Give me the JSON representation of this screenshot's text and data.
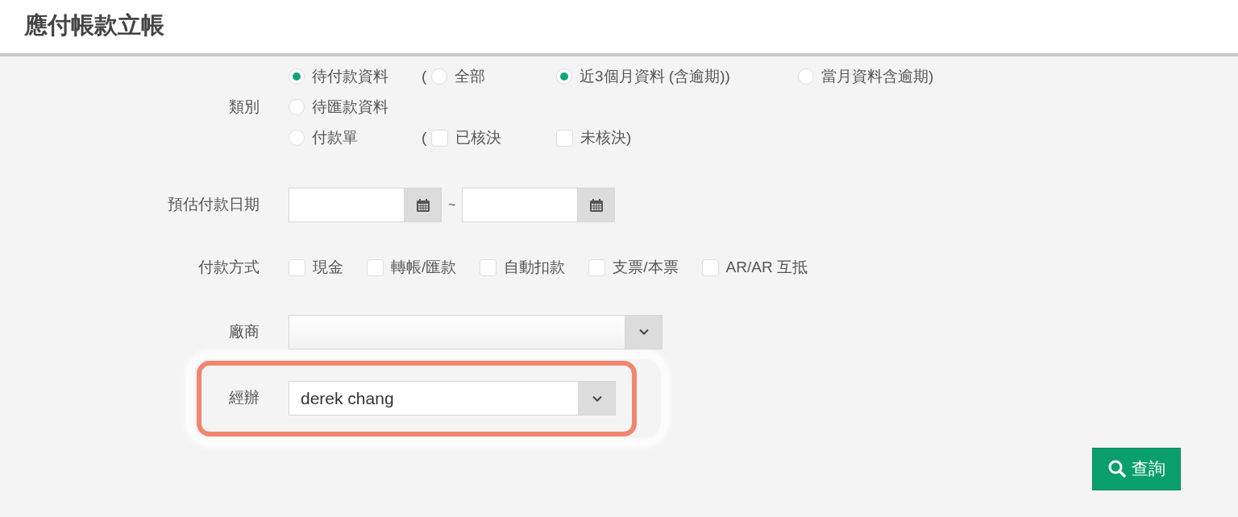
{
  "page_title": "應付帳款立帳",
  "category": {
    "label": "類別",
    "rows": [
      [
        [
          {
            "kind": "radio",
            "label": "待付款資料",
            "selected": true
          }
        ],
        [
          {
            "kind": "text",
            "text": "("
          },
          {
            "kind": "radio",
            "label": "全部",
            "selected": false
          }
        ],
        [
          {
            "kind": "radio",
            "label": "近3個月資料 (含逾期))",
            "selected": true
          }
        ],
        [
          {
            "kind": "radio",
            "label": "當月資料含逾期)",
            "selected": false
          }
        ]
      ],
      [
        [
          {
            "kind": "radio",
            "label": "待匯款資料",
            "selected": false
          }
        ]
      ],
      [
        [
          {
            "kind": "radio",
            "label": "付款單",
            "selected": false
          }
        ],
        [
          {
            "kind": "text",
            "text": "("
          },
          {
            "kind": "checkbox",
            "label": "已核決",
            "checked": false
          }
        ],
        [
          {
            "kind": "checkbox",
            "label": "未核決)",
            "checked": false
          }
        ]
      ]
    ]
  },
  "date": {
    "label": "預估付款日期",
    "separator": "~"
  },
  "payment": {
    "label": "付款方式",
    "options": [
      {
        "label": "現金",
        "checked": false
      },
      {
        "label": "轉帳/匯款",
        "checked": false
      },
      {
        "label": "自動扣款",
        "checked": false
      },
      {
        "label": "支票/本票",
        "checked": false
      },
      {
        "label": "AR/AR 互抵",
        "checked": false
      }
    ]
  },
  "vendor": {
    "label": "廠商"
  },
  "handler": {
    "label": "經辦",
    "value": "derek chang",
    "highlighted": true
  },
  "search_button": "查詢"
}
